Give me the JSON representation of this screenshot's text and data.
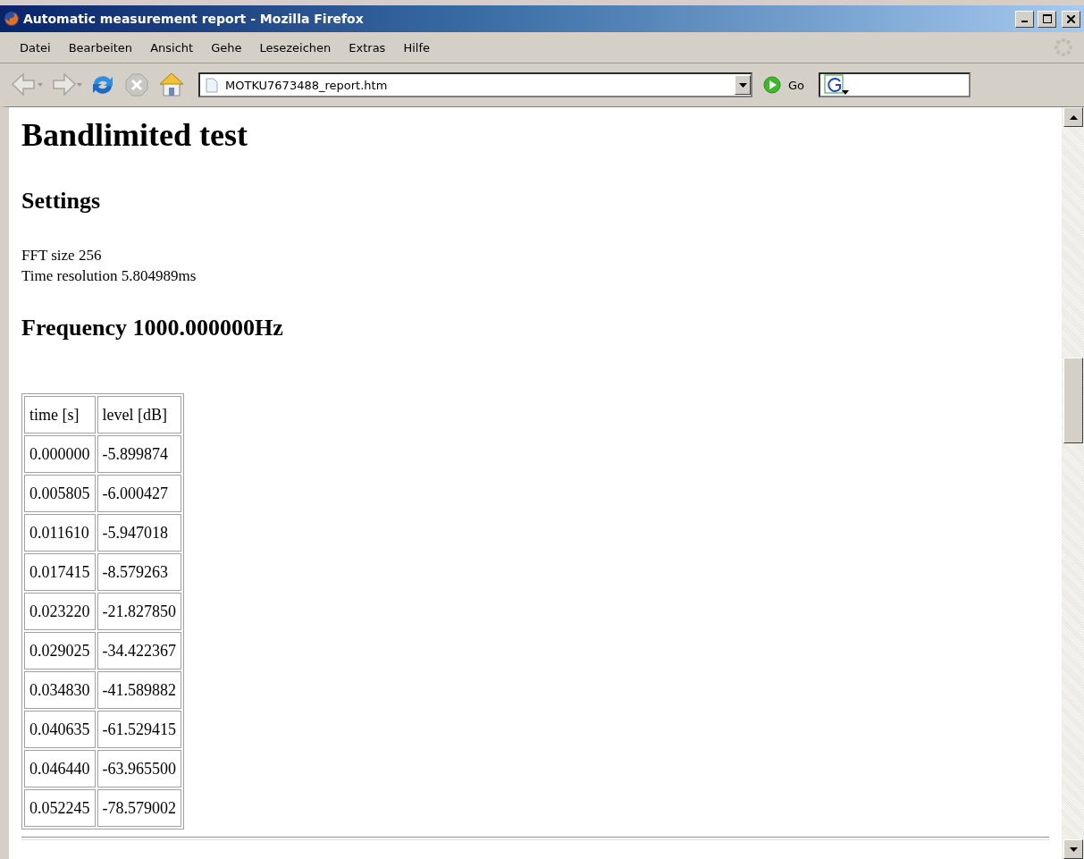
{
  "window": {
    "title": "Automatic measurement report - Mozilla Firefox"
  },
  "menu": [
    "Datei",
    "Bearbeiten",
    "Ansicht",
    "Gehe",
    "Lesezeichen",
    "Extras",
    "Hilfe"
  ],
  "toolbar": {
    "address": "MOTKU7673488_report.htm",
    "go_label": "Go"
  },
  "page": {
    "title": "Bandlimited test",
    "settings_heading": "Settings",
    "settings": [
      "FFT size 256",
      "Time resolution 5.804989ms"
    ],
    "frequency_heading": "Frequency 1000.000000Hz",
    "table": {
      "columns": [
        "time [s]",
        "level [dB]"
      ],
      "rows": [
        [
          "0.000000",
          "-5.899874"
        ],
        [
          "0.005805",
          "-6.000427"
        ],
        [
          "0.011610",
          "-5.947018"
        ],
        [
          "0.017415",
          "-8.579263"
        ],
        [
          "0.023220",
          "-21.827850"
        ],
        [
          "0.029025",
          "-34.422367"
        ],
        [
          "0.034830",
          "-41.589882"
        ],
        [
          "0.040635",
          "-61.529415"
        ],
        [
          "0.046440",
          "-63.965500"
        ],
        [
          "0.052245",
          "-78.579002"
        ]
      ]
    }
  }
}
